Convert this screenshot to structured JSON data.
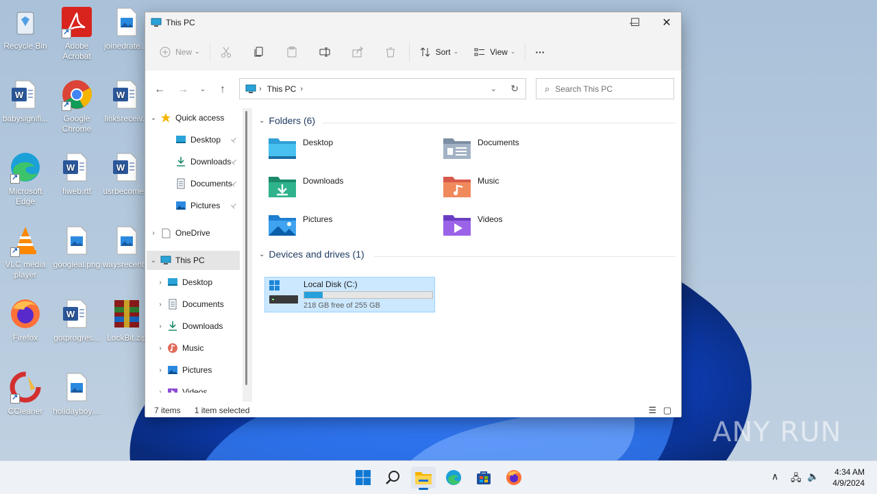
{
  "desktop": {
    "icons": [
      {
        "label": "Recycle Bin",
        "icon": "recycle-bin-icon"
      },
      {
        "label": "Adobe Acrobat",
        "icon": "acrobat-icon"
      },
      {
        "label": "joinedrate....",
        "icon": "image-file-icon"
      },
      {
        "label": "babysignifi...",
        "icon": "word-doc-icon"
      },
      {
        "label": "Google Chrome",
        "icon": "chrome-icon"
      },
      {
        "label": "linksreceiv...",
        "icon": "word-doc-icon"
      },
      {
        "label": "Microsoft Edge",
        "icon": "edge-icon"
      },
      {
        "label": "fiweb.rtf",
        "icon": "word-doc-icon"
      },
      {
        "label": "usrbecome...",
        "icon": "word-doc-icon"
      },
      {
        "label": "VLC media player",
        "icon": "vlc-icon"
      },
      {
        "label": "googleal.png",
        "icon": "image-file-icon"
      },
      {
        "label": "waysrecent...",
        "icon": "image-file-icon"
      },
      {
        "label": "Firefox",
        "icon": "firefox-icon"
      },
      {
        "label": "gotprogres...",
        "icon": "word-doc-icon"
      },
      {
        "label": "LockBit.zip",
        "icon": "winrar-icon"
      },
      {
        "label": "CCleaner",
        "icon": "ccleaner-icon"
      },
      {
        "label": "holidayboy....",
        "icon": "image-file-icon"
      }
    ]
  },
  "window": {
    "title": "This PC",
    "controls": {
      "minimize": "—",
      "maximize": "☐",
      "close": "✕"
    }
  },
  "toolbar": {
    "new_label": "New",
    "sort_label": "Sort",
    "view_label": "View",
    "more_label": "···"
  },
  "address": {
    "location": "This PC"
  },
  "search": {
    "placeholder": "Search This PC"
  },
  "nav": {
    "items": [
      {
        "label": "Quick access",
        "icon": "star-icon"
      },
      {
        "label": "Desktop",
        "icon": "desktop-folder-icon",
        "pinned": true
      },
      {
        "label": "Downloads",
        "icon": "downloads-icon",
        "pinned": true
      },
      {
        "label": "Documents",
        "icon": "documents-icon",
        "pinned": true
      },
      {
        "label": "Pictures",
        "icon": "pictures-icon",
        "pinned": true
      },
      {
        "label": "OneDrive",
        "icon": "onedrive-icon"
      },
      {
        "label": "This PC",
        "icon": "pc-icon",
        "selected": true
      },
      {
        "label": "Desktop",
        "icon": "desktop-folder-icon"
      },
      {
        "label": "Documents",
        "icon": "documents-icon"
      },
      {
        "label": "Downloads",
        "icon": "downloads-icon"
      },
      {
        "label": "Music",
        "icon": "music-icon"
      },
      {
        "label": "Pictures",
        "icon": "pictures-icon"
      },
      {
        "label": "Videos",
        "icon": "videos-icon"
      }
    ],
    "pin_glyph": "📌"
  },
  "main": {
    "folders_header": "Folders (6)",
    "folders": [
      {
        "label": "Desktop",
        "icon": "desktop-folder-icon"
      },
      {
        "label": "Documents",
        "icon": "documents-folder-icon"
      },
      {
        "label": "Downloads",
        "icon": "downloads-folder-icon"
      },
      {
        "label": "Music",
        "icon": "music-folder-icon"
      },
      {
        "label": "Pictures",
        "icon": "pictures-folder-icon"
      },
      {
        "label": "Videos",
        "icon": "videos-folder-icon"
      }
    ],
    "devices_header": "Devices and drives (1)",
    "drive": {
      "name": "Local Disk (C:)",
      "free_text": "218 GB free of 255 GB",
      "used_fraction": 0.145
    }
  },
  "status": {
    "items_count": "7 items",
    "selected": "1 item selected"
  },
  "taskbar": {
    "apps": [
      "start-icon",
      "search-icon",
      "file-explorer-icon",
      "edge-icon",
      "store-icon",
      "firefox-icon"
    ],
    "time": "4:34 AM",
    "date": "4/9/2024"
  },
  "watermark": "ANY RUN",
  "colors": {
    "accent": "#0067c0",
    "selection": "#cce8ff",
    "drive_bar": "#26a0da"
  }
}
